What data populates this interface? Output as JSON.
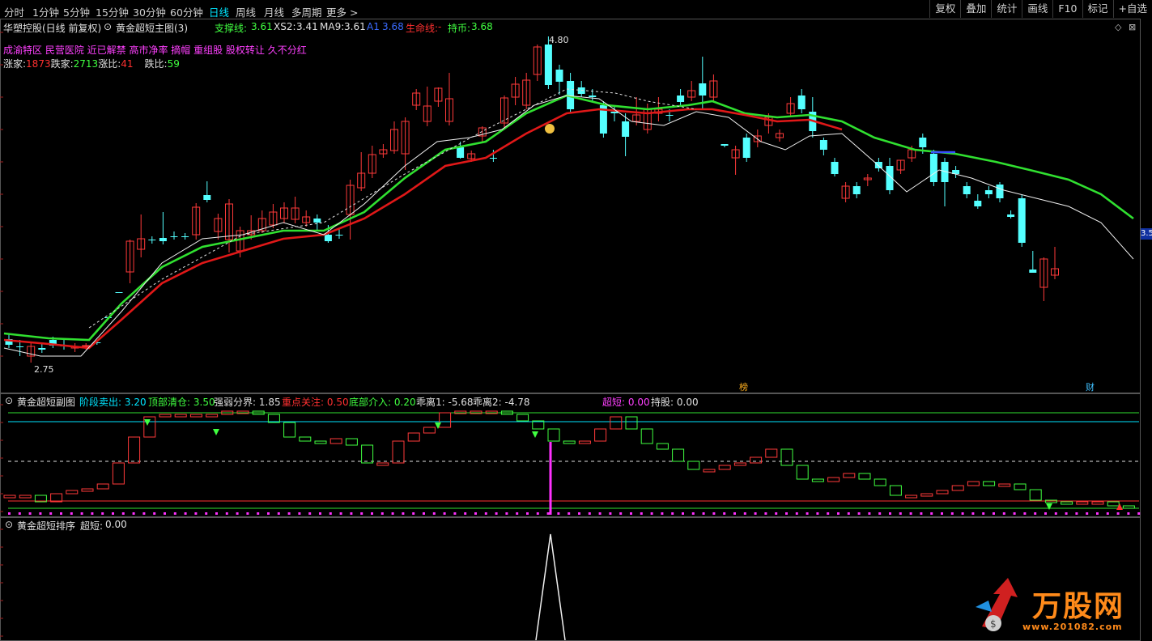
{
  "toolbar": {
    "periods": [
      "分时",
      "1分钟",
      "5分钟",
      "15分钟",
      "30分钟",
      "60分钟",
      "日线",
      "周线",
      "月线",
      "多周期",
      "更多 >"
    ],
    "active_period": "日线",
    "right_buttons": [
      "复权",
      "叠加",
      "统计",
      "画线",
      "F10",
      "标记",
      "+自选"
    ]
  },
  "main_panel": {
    "stock_title": "华塑控股(日线 前复权)",
    "indicator_name": "黄金超短主图(3)",
    "legend": [
      {
        "label": "支撑线:",
        "value": "3.61",
        "color": "#40ff40"
      },
      {
        "label": "XS2:",
        "value": "3.41",
        "color": "#e0e0e0"
      },
      {
        "label": "MA9:",
        "value": "3.61",
        "color": "#e0e0e0"
      },
      {
        "label": "A1",
        "value": "3.68",
        "color": "#3a6bff"
      },
      {
        "label": "生命线:",
        "value": "-",
        "color": "#ff3030"
      },
      {
        "label": "持币:",
        "value": "3.68",
        "color": "#40ff40"
      }
    ],
    "concepts": "成渝特区 民营医院 近已解禁 高市净率 摘帽 重组股 股权转让 久不分红",
    "breadth": {
      "up_label": "涨家:",
      "up_value": "1873",
      "down_label": "跌家:",
      "down_value": "2713",
      "up_ratio_label": "涨比:",
      "up_ratio_value": "41",
      "down_ratio_label": "跌比:",
      "down_ratio_value": "59"
    },
    "high_label": "4.80",
    "low_label": "2.75",
    "markers": [
      "榜",
      "财"
    ],
    "price_tag": "3.5"
  },
  "sub_panel": {
    "indicator_name": "黄金超短副图",
    "legend": [
      {
        "label": "阶段卖出:",
        "value": "3.20",
        "color": "#00e5ff"
      },
      {
        "label": "顶部清仓:",
        "value": "3.50",
        "color": "#40ff40"
      },
      {
        "label": "强弱分界:",
        "value": "1.85",
        "color": "#e0e0e0"
      },
      {
        "label": "重点关注:",
        "value": "0.50",
        "color": "#ff3030"
      },
      {
        "label": "底部介入:",
        "value": "0.20",
        "color": "#40ff40"
      },
      {
        "label": "乖离1:",
        "value": "-5.68",
        "color": "#e0e0e0"
      },
      {
        "label": "乖离2:",
        "value": "-4.78",
        "color": "#e0e0e0"
      },
      {
        "label": "超短:",
        "value": "0.00",
        "color": "#ff40ff"
      },
      {
        "label": "持股:",
        "value": "0.00",
        "color": "#e0e0e0"
      }
    ]
  },
  "bottom_panel": {
    "indicator_name": "黄金超短排序",
    "legend_label": "超短:",
    "legend_value": "0.00"
  },
  "watermark": {
    "brand": "万股网",
    "url": "www.201082.com"
  },
  "colors": {
    "up_candle": "#ff3a3a",
    "down_candle": "#54ffff",
    "support_line": "#30e030",
    "life_line": "#e01818",
    "ma_line": "#f0f0f0",
    "highlight": "#00e5ff",
    "magenta": "#ff30ff"
  }
}
